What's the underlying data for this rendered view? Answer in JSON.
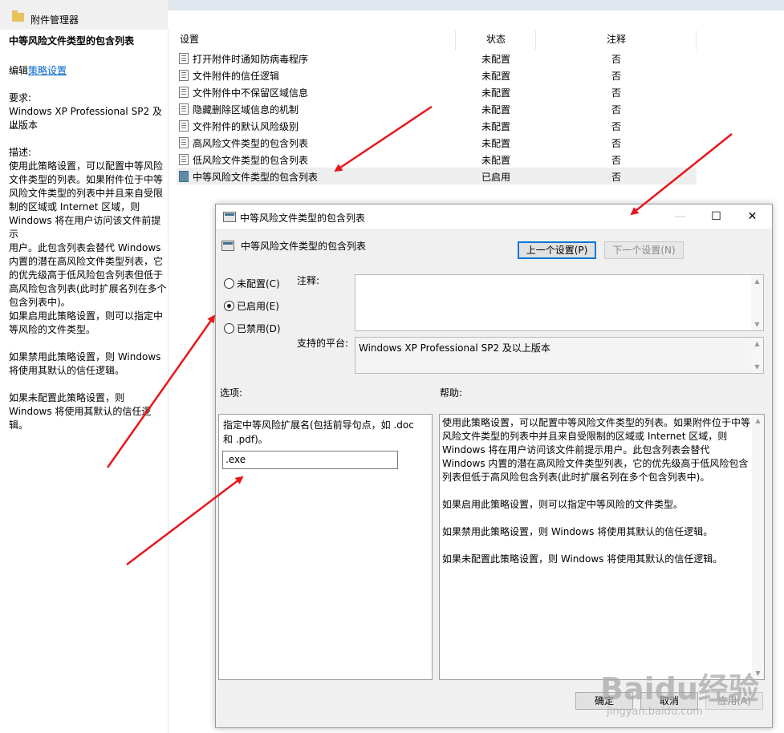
{
  "window": {
    "title": "附件管理器"
  },
  "description_pane": {
    "heading": "中等风险文件类型的包含列表",
    "edit_prefix": "编辑",
    "edit_link": "策略设置",
    "requirements_label": "要求:",
    "requirements_line1": "Windows XP Professional SP2 及以",
    "requirements_line2": "上版本",
    "description_label": "描述:",
    "description_lines": [
      "使用此策略设置，可以配置中等风险",
      "文件类型的列表。如果附件位于中等",
      "风险文件类型的列表中并且来自受限",
      "制的区域或 Internet 区域，则",
      "Windows 将在用户访问该文件前提示",
      "用户。此包含列表会替代 Windows",
      "内置的潜在高风险文件类型列表，它",
      "的优先级高于低风险包含列表但低于",
      "高风险包含列表(此时扩展名列在多个",
      "包含列表中)。"
    ],
    "enabled_lines": [
      "如果启用此策略设置，则可以指定中",
      "等风险的文件类型。"
    ],
    "disabled_lines": [
      "如果禁用此策略设置，则 Windows",
      "将使用其默认的信任逻辑。"
    ],
    "notconfigured_lines": [
      "如果未配置此策略设置，则",
      "Windows 将使用其默认的信任逻辑。"
    ]
  },
  "list": {
    "columns": {
      "setting": "设置",
      "state": "状态",
      "comment": "注释"
    },
    "rows": [
      {
        "name": "打开附件时通知防病毒程序",
        "state": "未配置",
        "comment": "否"
      },
      {
        "name": "文件附件的信任逻辑",
        "state": "未配置",
        "comment": "否"
      },
      {
        "name": "文件附件中不保留区域信息",
        "state": "未配置",
        "comment": "否"
      },
      {
        "name": "隐藏删除区域信息的机制",
        "state": "未配置",
        "comment": "否"
      },
      {
        "name": "文件附件的默认风险级别",
        "state": "未配置",
        "comment": "否"
      },
      {
        "name": "高风险文件类型的包含列表",
        "state": "未配置",
        "comment": "否"
      },
      {
        "name": "低风险文件类型的包含列表",
        "state": "未配置",
        "comment": "否"
      },
      {
        "name": "中等风险文件类型的包含列表",
        "state": "已启用",
        "comment": "否"
      }
    ]
  },
  "dialog": {
    "title": "中等风险文件类型的包含列表",
    "policy_name": "中等风险文件类型的包含列表",
    "prev_button": "上一个设置(P)",
    "next_button": "下一个设置(N)",
    "radio_not_configured": "未配置(C)",
    "radio_enabled": "已启用(E)",
    "radio_disabled": "已禁用(D)",
    "selected_option": "已启用(E)",
    "comment_label": "注释:",
    "comment_value": "",
    "platform_label": "支持的平台:",
    "platform_value": "Windows XP Professional SP2 及以上版本",
    "options_label": "选项:",
    "help_label": "帮助:",
    "options_prompt_line1": "指定中等风险扩展名(包括前导句点，如 .doc",
    "options_prompt_line2": "和 .pdf)。",
    "extension_value": ".exe",
    "help_paragraphs": [
      "使用此策略设置，可以配置中等风险文件类型的列表。如果附件位于中等风险文件类型的列表中并且来自受限制的区域或 Internet 区域，则 Windows 将在用户访问该文件前提示用户。此包含列表会替代 Windows 内置的潜在高风险文件类型列表，它的优先级高于低风险包含列表但低于高风险包含列表(此时扩展名列在多个包含列表中)。",
      "如果启用此策略设置，则可以指定中等风险的文件类型。",
      "如果禁用此策略设置，则 Windows 将使用其默认的信任逻辑。",
      "如果未配置此策略设置，则 Windows 将使用其默认的信任逻辑。"
    ],
    "ok_button": "确定",
    "cancel_button": "取消",
    "apply_button": "应用(A)"
  },
  "watermark": {
    "logo": "Baidu经验",
    "url": "jingyan.baidu.com"
  },
  "annotation_color": "#e8161b"
}
